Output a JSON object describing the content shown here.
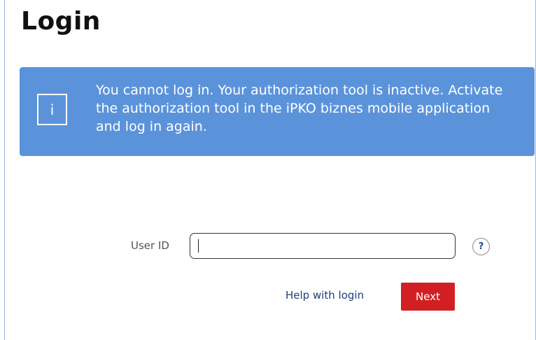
{
  "page": {
    "title": "Login"
  },
  "alert": {
    "icon": "info-icon",
    "icon_glyph": "i",
    "message": "You cannot log in. Your authorization tool is inactive. Activate the authorization tool in the iPKO biznes mobile application and log in again.",
    "color": "#5b93db"
  },
  "form": {
    "user_id_label": "User ID",
    "user_id_value": "",
    "help_icon": "question-mark-icon",
    "help_glyph": "?",
    "help_link_label": "Help with login",
    "next_label": "Next",
    "next_color": "#d21f23"
  }
}
